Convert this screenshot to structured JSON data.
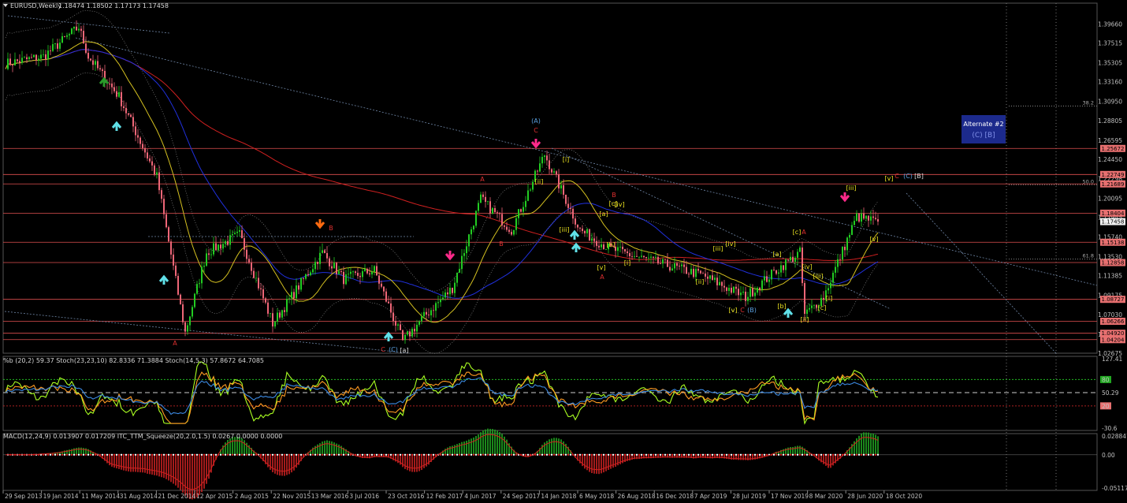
{
  "colors": {
    "background": "#000000",
    "bull": "#22cc22",
    "bear": "#ee6677",
    "grid": "#3a3a3a",
    "hline": "#e05050",
    "ma_slow": "#d02020",
    "ma_mid": "#2030dd",
    "ma_fast": "#d4c020",
    "trend": "#6f86a6",
    "stoch_main": "#aaff22",
    "stoch_signal": "#ff9a22",
    "stoch_slow": "#3b88e0",
    "macd_pos": "#22aa22",
    "macd_neg": "#cc2222",
    "arrow_down": "#ff2a8a",
    "arrow_up": "#60e0e8",
    "arrow_orange": "#ff6a10",
    "arrow_green": "#2a9a2a",
    "alt_box": "#1c2a8c"
  },
  "header": {
    "menu_icon": "triangle-down-icon",
    "symbol": "EURUSD,Weekly",
    "ohlc": "1.18474 1.18502 1.17173 1.17458"
  },
  "alternate_box": {
    "line1": "Alternate #2",
    "line2": "(C) [B]"
  },
  "price_scale_labels": [
    "1.39660",
    "1.37515",
    "1.35305",
    "1.33160",
    "1.30950",
    "1.28805",
    "1.26595",
    "1.24450",
    "1.22298",
    "1.20095",
    "1.17945",
    "1.15740",
    "1.13530",
    "1.11385",
    "1.09175",
    "1.07030",
    "1.04820",
    "1.02675"
  ],
  "level_tags": [
    "1.25672",
    "1.22749",
    "1.21689",
    "1.18404",
    "1.17458",
    "1.15138",
    "1.12858",
    "1.08727",
    "1.06266",
    "1.04920",
    "1.04204"
  ],
  "fib_labels": [
    "38.2",
    "50.0",
    "61.8"
  ],
  "date_labels": [
    "29 Sep 2013",
    "19 Jan 2014",
    "11 May 2014",
    "31 Aug 2014",
    "21 Dec 2014",
    "12 Apr 2015",
    "2 Aug 2015",
    "22 Nov 2015",
    "13 Mar 2016",
    "3 Jul 2016",
    "23 Oct 2016",
    "12 Feb 2017",
    "4 Jun 2017",
    "24 Sep 2017",
    "14 Jan 2018",
    "6 May 2018",
    "26 Aug 2018",
    "16 Dec 2018",
    "7 Apr 2019",
    "28 Jul 2019",
    "17 Nov 2019",
    "8 Mar 2020",
    "28 Jun 2020",
    "18 Oct 2020"
  ],
  "indicator1": {
    "legend": "%b (20,2) 59.37  Stoch(23,23,10) 82.8336 71.3884  Stoch(14,5,3) 57.8672 64.7085",
    "scale": [
      "127.41",
      "80",
      "50.29",
      "20",
      "-30.6"
    ]
  },
  "indicator2": {
    "legend": "MACD(12,24,9) 0.013907 0.017209  ITC_TTM_Squeeze(20,2.0,1.5) 0.0267 0.0000 0.0000",
    "scale": [
      "0.028847",
      "0.00",
      "-0.051174"
    ]
  },
  "waves": [
    {
      "t": "(A)",
      "c": "#5aa0e0"
    },
    {
      "t": "C",
      "c": "#e03030"
    },
    {
      "t": "A",
      "c": "#e03030"
    },
    {
      "t": "B",
      "c": "#e03030"
    },
    {
      "t": "A",
      "c": "#e03030"
    },
    {
      "t": "B",
      "c": "#e03030"
    },
    {
      "t": "A",
      "c": "#e03030"
    },
    {
      "t": "B",
      "c": "#e03030"
    },
    {
      "t": "C",
      "c": "#e03030"
    },
    {
      "t": "(C)",
      "c": "#5aa0e0"
    },
    {
      "t": "[a]",
      "c": "#d8d8d8"
    },
    {
      "t": "[i]",
      "c": "#e8e020"
    },
    {
      "t": "[ii]",
      "c": "#e8e020"
    },
    {
      "t": "[iii]",
      "c": "#e8e020"
    },
    {
      "t": "[iv]",
      "c": "#e8e020"
    },
    {
      "t": "[v]",
      "c": "#e8e020"
    },
    {
      "t": "[a]",
      "c": "#e8e020"
    },
    {
      "t": "[b]",
      "c": "#e8e020"
    },
    {
      "t": "[c]",
      "c": "#e8e020"
    },
    {
      "t": "[i]",
      "c": "#e8e020"
    },
    {
      "t": "[ii]",
      "c": "#e8e020"
    },
    {
      "t": "[iii]",
      "c": "#e8e020"
    },
    {
      "t": "[iv]",
      "c": "#e8e020"
    },
    {
      "t": "[v]",
      "c": "#e8e020"
    },
    {
      "t": "C",
      "c": "#e03030"
    },
    {
      "t": "(B)",
      "c": "#5aa0e0"
    },
    {
      "t": "[c]",
      "c": "#e8e020"
    },
    {
      "t": "A",
      "c": "#e03030"
    },
    {
      "t": "[a]",
      "c": "#e8e020"
    },
    {
      "t": "[b]",
      "c": "#e8e020"
    },
    {
      "t": "[c]",
      "c": "#e8e020"
    },
    {
      "t": "[i]",
      "c": "#e8e020"
    },
    {
      "t": "[ii]",
      "c": "#e8e020"
    },
    {
      "t": "[iii]",
      "c": "#e8e020"
    },
    {
      "t": "[iv]",
      "c": "#e8e020"
    },
    {
      "t": "[iii]",
      "c": "#e8e020"
    },
    {
      "t": "[v]",
      "c": "#e8e020"
    },
    {
      "t": "C",
      "c": "#e03030"
    },
    {
      "t": "(C)",
      "c": "#5aa0e0"
    },
    {
      "t": "[B]",
      "c": "#d8d8d8"
    }
  ],
  "chart_data": {
    "type": "candlestick",
    "symbol": "EURUSD",
    "timeframe": "Weekly",
    "ylim": [
      1.0268,
      1.411
    ],
    "horizontal_levels": [
      1.25672,
      1.22749,
      1.21689,
      1.18404,
      1.15138,
      1.12858,
      1.08727,
      1.06266,
      1.0492,
      1.04204
    ],
    "last": 1.17458,
    "anchors": [
      {
        "date": "2013-09-29",
        "close": 1.352
      },
      {
        "date": "2014-01-19",
        "close": 1.36
      },
      {
        "date": "2014-05-04",
        "close": 1.393
      },
      {
        "date": "2014-06-01",
        "close": 1.36
      },
      {
        "date": "2014-08-31",
        "close": 1.315
      },
      {
        "date": "2014-12-21",
        "close": 1.225
      },
      {
        "date": "2015-03-15",
        "close": 1.05
      },
      {
        "date": "2015-05-17",
        "close": 1.14
      },
      {
        "date": "2015-08-23",
        "close": 1.16
      },
      {
        "date": "2015-11-29",
        "close": 1.06
      },
      {
        "date": "2016-04-24",
        "close": 1.14
      },
      {
        "date": "2016-06-26",
        "close": 1.11
      },
      {
        "date": "2016-09-25",
        "close": 1.12
      },
      {
        "date": "2016-12-18",
        "close": 1.04
      },
      {
        "date": "2017-02-12",
        "close": 1.065
      },
      {
        "date": "2017-05-14",
        "close": 1.1
      },
      {
        "date": "2017-08-06",
        "close": 1.2
      },
      {
        "date": "2017-11-05",
        "close": 1.165
      },
      {
        "date": "2018-02-11",
        "close": 1.25
      },
      {
        "date": "2018-05-27",
        "close": 1.165
      },
      {
        "date": "2018-08-19",
        "close": 1.145
      },
      {
        "date": "2018-11-11",
        "close": 1.135
      },
      {
        "date": "2019-05-19",
        "close": 1.115
      },
      {
        "date": "2019-09-29",
        "close": 1.09
      },
      {
        "date": "2019-12-29",
        "close": 1.12
      },
      {
        "date": "2020-03-08",
        "close": 1.14
      },
      {
        "date": "2020-03-22",
        "close": 1.07
      },
      {
        "date": "2020-05-17",
        "close": 1.09
      },
      {
        "date": "2020-08-23",
        "close": 1.18
      },
      {
        "date": "2020-10-18",
        "close": 1.1746
      }
    ]
  }
}
